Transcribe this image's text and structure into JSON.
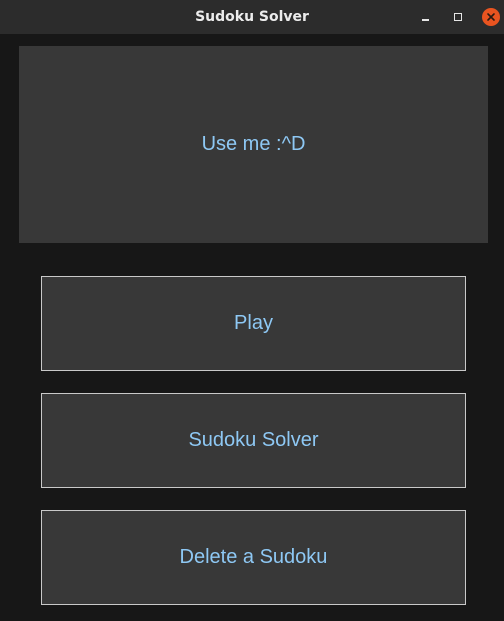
{
  "window": {
    "title": "Sudoku Solver",
    "controls": [
      "minimize-icon",
      "maximize-icon",
      "close-icon"
    ]
  },
  "banner": {
    "text": "Use me :^D"
  },
  "menu": {
    "play_label": "Play",
    "solver_label": "Sudoku Solver",
    "delete_label": "Delete a Sudoku"
  },
  "colors": {
    "background": "#171717",
    "panel": "#383838",
    "text_accent": "#8ec8f4",
    "button_border": "#c9c9c9",
    "close_button": "#e95420"
  }
}
